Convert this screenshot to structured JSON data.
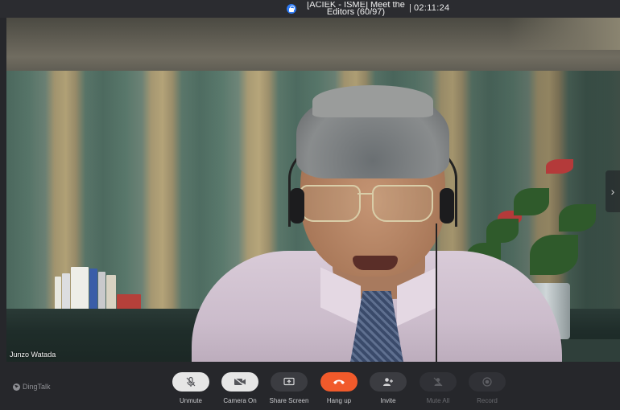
{
  "window": {
    "meeting_title": "[ACIEK - ISME] Meet the Editors (60/97)",
    "timer_separator": "|",
    "timer": "02:11:24"
  },
  "video": {
    "participant_name": "Junzo Watada",
    "next_page_glyph": "›"
  },
  "toolbar": {
    "brand": "DingTalk",
    "buttons": [
      {
        "label": "Unmute",
        "icon": "mic-muted-icon",
        "state": "muted"
      },
      {
        "label": "Camera On",
        "icon": "camera-icon",
        "state": "off"
      },
      {
        "label": "Share Screen",
        "icon": "share-screen-icon",
        "state": "idle"
      },
      {
        "label": "Hang up",
        "icon": "hang-up-icon",
        "state": "danger"
      },
      {
        "label": "Invite",
        "icon": "add-person-icon",
        "state": "idle"
      },
      {
        "label": "Mute All",
        "icon": "mute-all-icon",
        "state": "disabled"
      },
      {
        "label": "Record",
        "icon": "record-icon",
        "state": "disabled"
      }
    ]
  },
  "colors": {
    "background": "#26272b",
    "hang_up": "#f15a2b",
    "lock_badge": "#2f7cf6"
  }
}
